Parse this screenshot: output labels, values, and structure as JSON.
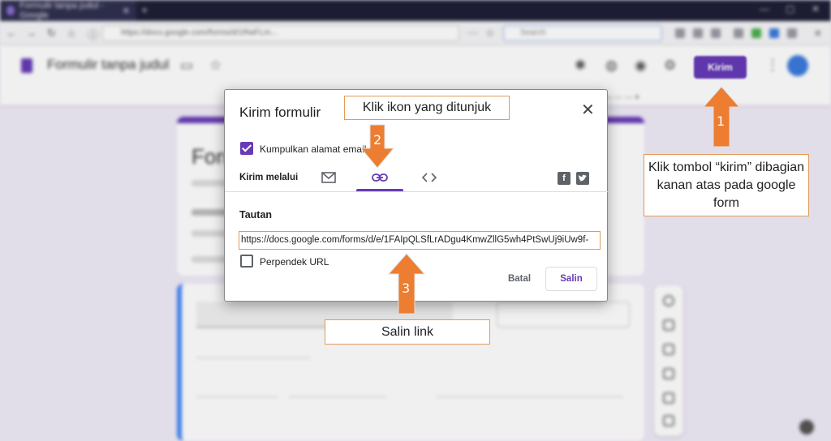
{
  "browser": {
    "tab_title": "Formulir tanpa judul - Google",
    "address": "https://docs.google.com/forms/d/1RwFLm...",
    "search_placeholder": "Search"
  },
  "app": {
    "doc_title": "Formulir tanpa judul",
    "send_button": "Kirim",
    "form_title_partial": "Form"
  },
  "dialog": {
    "title": "Kirim formulir",
    "collect_email_label": "Kumpulkan alamat email",
    "collect_email_checked": true,
    "send_via_label": "Kirim melalui",
    "send_tabs": [
      {
        "icon": "email-icon",
        "active": false
      },
      {
        "icon": "link-icon",
        "active": true
      },
      {
        "icon": "embed-code-icon",
        "active": false
      }
    ],
    "social": [
      "facebook-icon",
      "twitter-icon"
    ],
    "link_section_label": "Tautan",
    "link_value": "https://docs.google.com/forms/d/e/1FAIpQLSfLrADgu4KmwZllG5wh4PtSwUj9iUw9f-",
    "shorten_url_label": "Perpendek URL",
    "shorten_url_checked": false,
    "cancel_button": "Batal",
    "copy_button": "Salin"
  },
  "annotations": {
    "step1_number": "1",
    "step1_text": "Klik tombol “kirim” dibagian kanan atas pada google form",
    "step2_number": "2",
    "step2_text": "Klik ikon yang ditunjuk",
    "step3_number": "3",
    "step3_text": "Salin link",
    "arrow_color": "#ed7d31"
  },
  "colors": {
    "brand": "#673ab7",
    "background": "#f0ebf8",
    "callout_border": "#e39a5a"
  }
}
